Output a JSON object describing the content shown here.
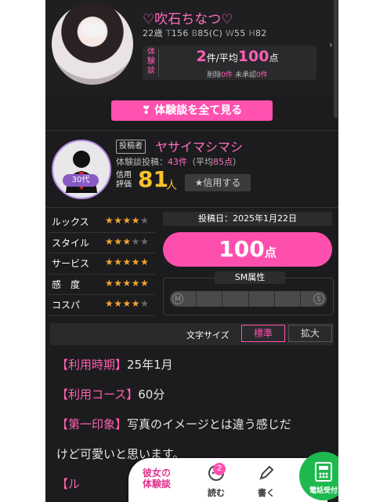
{
  "girl": {
    "name": "♡吹石ちなつ♡",
    "age": "22歳",
    "t_label": "T",
    "t": "156",
    "b_label": "B",
    "b": "85(C)",
    "w_label": "W",
    "w": "55",
    "h_label": "H",
    "h": "82"
  },
  "review_summary": {
    "label": "体験談",
    "count": "2",
    "count_unit": "件/平均",
    "avg": "100",
    "avg_unit": "点",
    "deleted_label": "削除",
    "deleted": "0件",
    "pending_label": "未承認",
    "pending": "0件"
  },
  "view_all_label": "体験談を全て見る",
  "reviewer": {
    "tag": "投稿者",
    "name": "ヤサイマシマシ",
    "age_badge": "30代",
    "posts_label": "体験談投稿：",
    "posts": "43件",
    "avg_prefix": "（平均",
    "avg": "85点",
    "avg_suffix": "）",
    "credit_label": "信用評価",
    "credit": "81",
    "credit_unit": "人",
    "credit_button": "★信用する"
  },
  "ratings": [
    {
      "label": "ルックス",
      "stars": 4
    },
    {
      "label": "スタイル",
      "stars": 3
    },
    {
      "label": "サービス",
      "stars": 5
    },
    {
      "label": "感　度",
      "stars": 5
    },
    {
      "label": "コスパ",
      "stars": 4
    }
  ],
  "post_date": "投稿日：2025年1月22日",
  "score": "100",
  "score_unit": "点",
  "sm": {
    "label": "SM属性",
    "left": "M",
    "right": "S"
  },
  "font_size": {
    "label": "文字サイズ",
    "standard": "標準",
    "large": "拡大"
  },
  "body": {
    "l1_key": "【利用時期】",
    "l1_val": "25年1月",
    "l2_key": "【利用コース】",
    "l2_val": "60分",
    "l3_key": "【第一印象】",
    "l3_val": "写真のイメージとは違う感じだ",
    "l4": "けど可愛いと思います。",
    "l5_key": "【ル"
  },
  "nav": {
    "review_label": "彼女の体験談",
    "read": "読む",
    "read_badge": "2",
    "write": "書く",
    "call": "電話受付"
  },
  "colors": {
    "accent": "#ff4fae",
    "star": "#f2a530",
    "call": "#1eb84f"
  }
}
